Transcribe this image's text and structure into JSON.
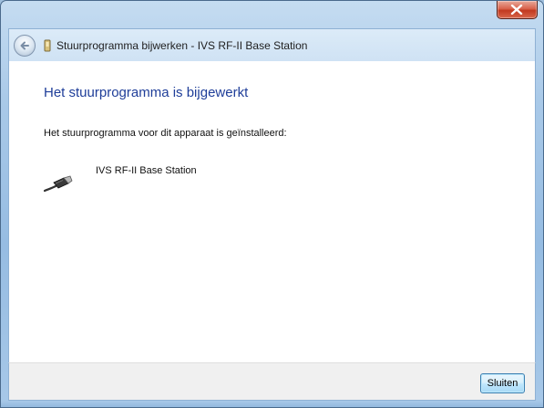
{
  "window": {
    "title": "Stuurprogramma bijwerken - IVS RF-II Base Station"
  },
  "content": {
    "heading": "Het stuurprogramma is bijgewerkt",
    "description": "Het stuurprogramma voor dit apparaat is geïnstalleerd:",
    "device": {
      "name": "IVS RF-II Base Station",
      "icon": "usb-plug-icon"
    }
  },
  "footer": {
    "close_label": "Sluiten"
  },
  "colors": {
    "heading": "#1f3e99",
    "close_button": "#c1391f",
    "frame": "#a9c9e8"
  }
}
